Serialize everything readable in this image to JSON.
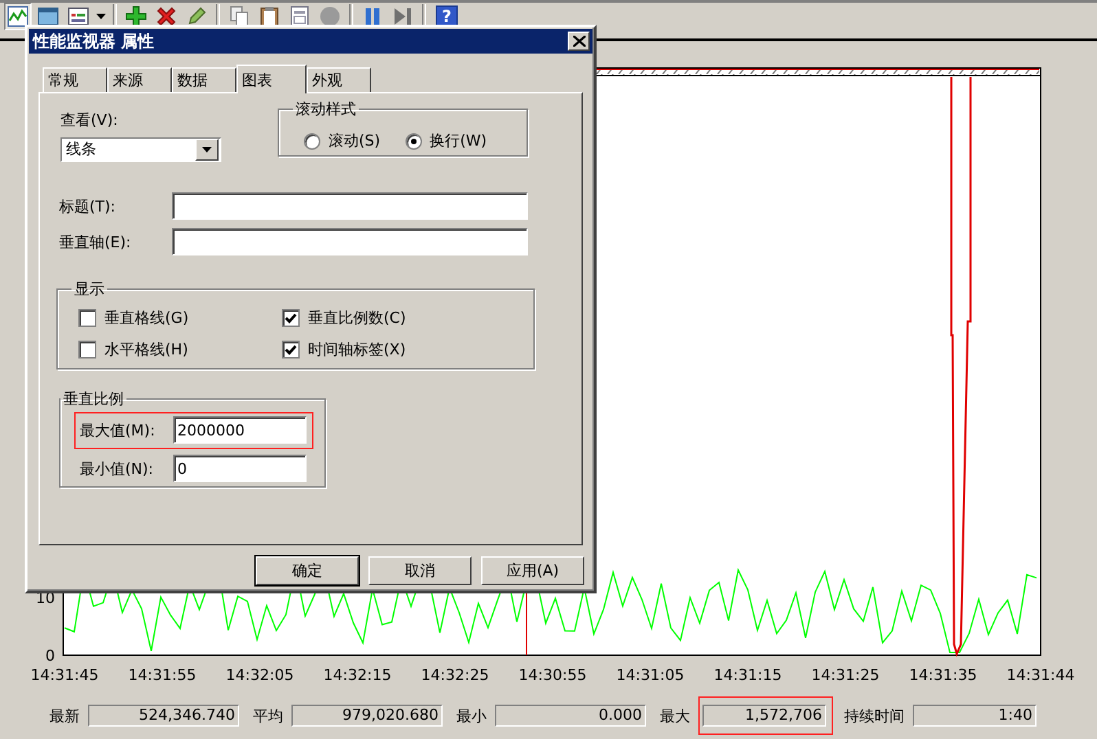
{
  "toolbar": [
    {
      "kind": "chart",
      "pressed": true
    },
    {
      "kind": "folder",
      "pressed": false
    },
    {
      "kind": "report",
      "pressed": false
    },
    {
      "kind": "separator"
    },
    {
      "kind": "add",
      "pressed": false
    },
    {
      "kind": "delete",
      "pressed": false
    },
    {
      "kind": "highlight",
      "pressed": false
    },
    {
      "kind": "separator"
    },
    {
      "kind": "copy",
      "pressed": false
    },
    {
      "kind": "paste",
      "pressed": false
    },
    {
      "kind": "properties",
      "pressed": false
    },
    {
      "kind": "freeze",
      "pressed": false
    },
    {
      "kind": "separator"
    },
    {
      "kind": "pause",
      "pressed": false
    },
    {
      "kind": "step",
      "pressed": false
    },
    {
      "kind": "separator"
    },
    {
      "kind": "help",
      "pressed": false,
      "label": "?"
    }
  ],
  "chart": {
    "y_ticks": [
      "10",
      "0"
    ],
    "x_labels": [
      "14:31:45",
      "14:31:55",
      "14:32:05",
      "14:32:15",
      "14:32:25",
      "14:30:55",
      "14:31:05",
      "14:31:15",
      "14:31:25",
      "14:31:35",
      "14:31:44"
    ]
  },
  "stats": [
    {
      "label": "最新",
      "value": "524,346.740",
      "highlighted": false
    },
    {
      "label": "平均",
      "value": "979,020.680",
      "highlighted": false
    },
    {
      "label": "最小",
      "value": "0.000",
      "highlighted": false
    },
    {
      "label": "最大",
      "value": "1,572,706",
      "highlighted": true
    },
    {
      "label": "持续时间",
      "value": "1:40",
      "highlighted": false
    }
  ],
  "dialog": {
    "title": "性能监视器 属性",
    "tabs": [
      {
        "label": "常规",
        "selected": false
      },
      {
        "label": "来源",
        "selected": false
      },
      {
        "label": "数据",
        "selected": false
      },
      {
        "label": "图表",
        "selected": true
      },
      {
        "label": "外观",
        "selected": false
      }
    ],
    "view": {
      "label": "查看(V):",
      "value": "线条"
    },
    "scroll_style": {
      "title": "滚动样式",
      "options": [
        {
          "label": "滚动(S)",
          "selected": false
        },
        {
          "label": "换行(W)",
          "selected": true
        }
      ]
    },
    "fields": [
      {
        "label": "标题(T):"
      },
      {
        "label": "垂直轴(E):"
      }
    ],
    "display": {
      "title": "显示",
      "options": [
        {
          "label": "垂直格线(G)",
          "checked": false
        },
        {
          "label": "垂直比例数(C)",
          "checked": true
        },
        {
          "label": "水平格线(H)",
          "checked": false
        },
        {
          "label": "时间轴标签(X)",
          "checked": true
        }
      ]
    },
    "vertical_scale": {
      "title": "垂直比例",
      "fields": [
        {
          "label": "最大值(M):",
          "value": "2000000",
          "highlighted": true
        },
        {
          "label": "最小值(N):",
          "value": "0",
          "highlighted": false
        }
      ]
    },
    "buttons": [
      {
        "label": "确定",
        "default": true
      },
      {
        "label": "取消",
        "default": false
      },
      {
        "label": "应用(A)",
        "default": false
      }
    ]
  }
}
